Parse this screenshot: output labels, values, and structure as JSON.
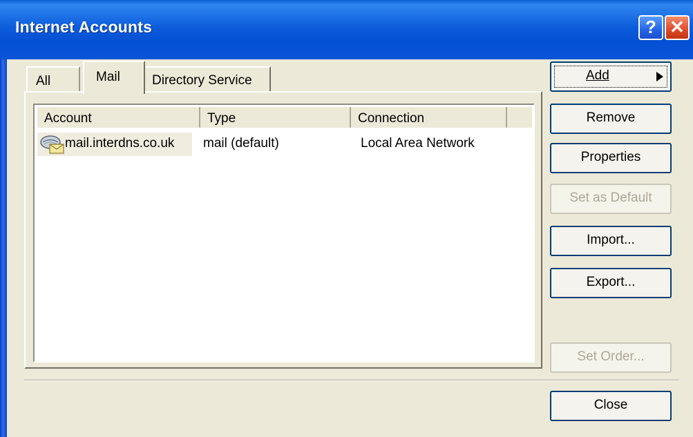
{
  "window": {
    "title": "Internet Accounts",
    "help_label": "?",
    "close_label": "✕"
  },
  "tabs": [
    {
      "label": "All"
    },
    {
      "label": "Mail"
    },
    {
      "label": "Directory Service"
    }
  ],
  "list": {
    "columns": [
      "Account",
      "Type",
      "Connection"
    ],
    "rows": [
      {
        "account": "mail.interdns.co.uk",
        "type": "mail (default)",
        "connection": "Local Area Network",
        "icon": "mail-account-icon"
      }
    ]
  },
  "buttons": {
    "add": "Add",
    "remove": "Remove",
    "properties": "Properties",
    "set_default": "Set as Default",
    "import": "Import...",
    "export": "Export...",
    "set_order": "Set Order...",
    "close": "Close"
  },
  "colors": {
    "titlebar": "#0a54d8",
    "face": "#ece9d8",
    "button_border": "#003c74",
    "disabled_text": "#aca899"
  }
}
